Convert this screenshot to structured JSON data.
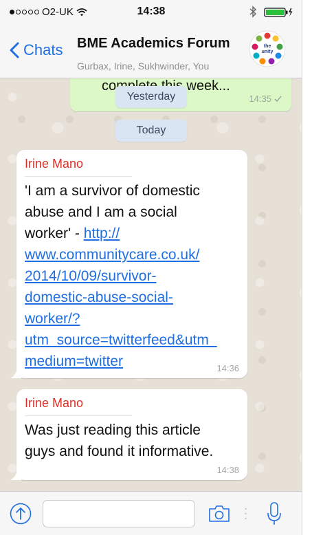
{
  "status_bar": {
    "carrier": "O2-UK",
    "time": "14:38",
    "signal_bars_filled": 1,
    "signal_bars_total": 5,
    "wifi_icon": "wifi-icon",
    "bluetooth_icon": "bluetooth-icon",
    "battery_icon": "battery-charging-icon"
  },
  "nav": {
    "back_label": "Chats",
    "title": "BME Academics Forum",
    "subtitle": "Gurbax, Irine, Sukhwinder, You",
    "avatar_label": "the unity"
  },
  "chat": {
    "outgoing_message": {
      "text": "complete this week...",
      "time": "14:35",
      "status_icon": "check-icon"
    },
    "date_separators": [
      "Yesterday",
      "Today"
    ],
    "messages": [
      {
        "sender": "Irine Mano",
        "lines": [
          "'I am a survivor of domestic",
          "abuse and I am a social"
        ],
        "line_prefix": "worker' - ",
        "link_lines": [
          "http://",
          "www.communitycare.co.uk/",
          "2014/10/09/survivor-",
          "domestic-abuse-social-",
          "worker/?",
          "utm_source=twitterfeed&utm_",
          "medium=twitter"
        ],
        "time": "14:36"
      },
      {
        "sender": "Irine Mano",
        "lines": [
          "Was just reading this article",
          "guys and found it informative."
        ],
        "time": "14:38"
      }
    ]
  },
  "input_bar": {
    "placeholder": "",
    "upload_icon": "upload-arrow-icon",
    "camera_icon": "camera-icon",
    "mic_icon": "microphone-icon"
  },
  "colors": {
    "accent_blue": "#1f6fe3",
    "sender_red": "#d9312a",
    "outgoing_green": "#dcf8c6",
    "date_chip": "#d9e5f2"
  }
}
